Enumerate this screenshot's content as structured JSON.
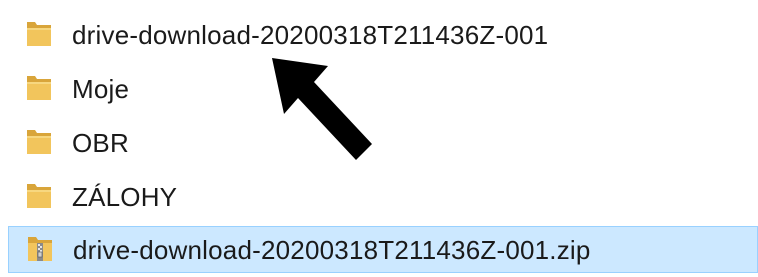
{
  "files": [
    {
      "name": "drive-download-20200318T211436Z-001",
      "icon": "folder-icon"
    },
    {
      "name": "Moje",
      "icon": "folder-icon"
    },
    {
      "name": "OBR",
      "icon": "folder-icon"
    },
    {
      "name": "ZÁLOHY",
      "icon": "folder-icon"
    },
    {
      "name": "drive-download-20200318T211436Z-001.zip",
      "icon": "zip-folder-icon",
      "selected": true
    }
  ],
  "colors": {
    "folder": "#e8b84a",
    "selection_bg": "#cce8ff",
    "selection_border": "#99d1ff",
    "annotation_arrow": "#000000"
  }
}
